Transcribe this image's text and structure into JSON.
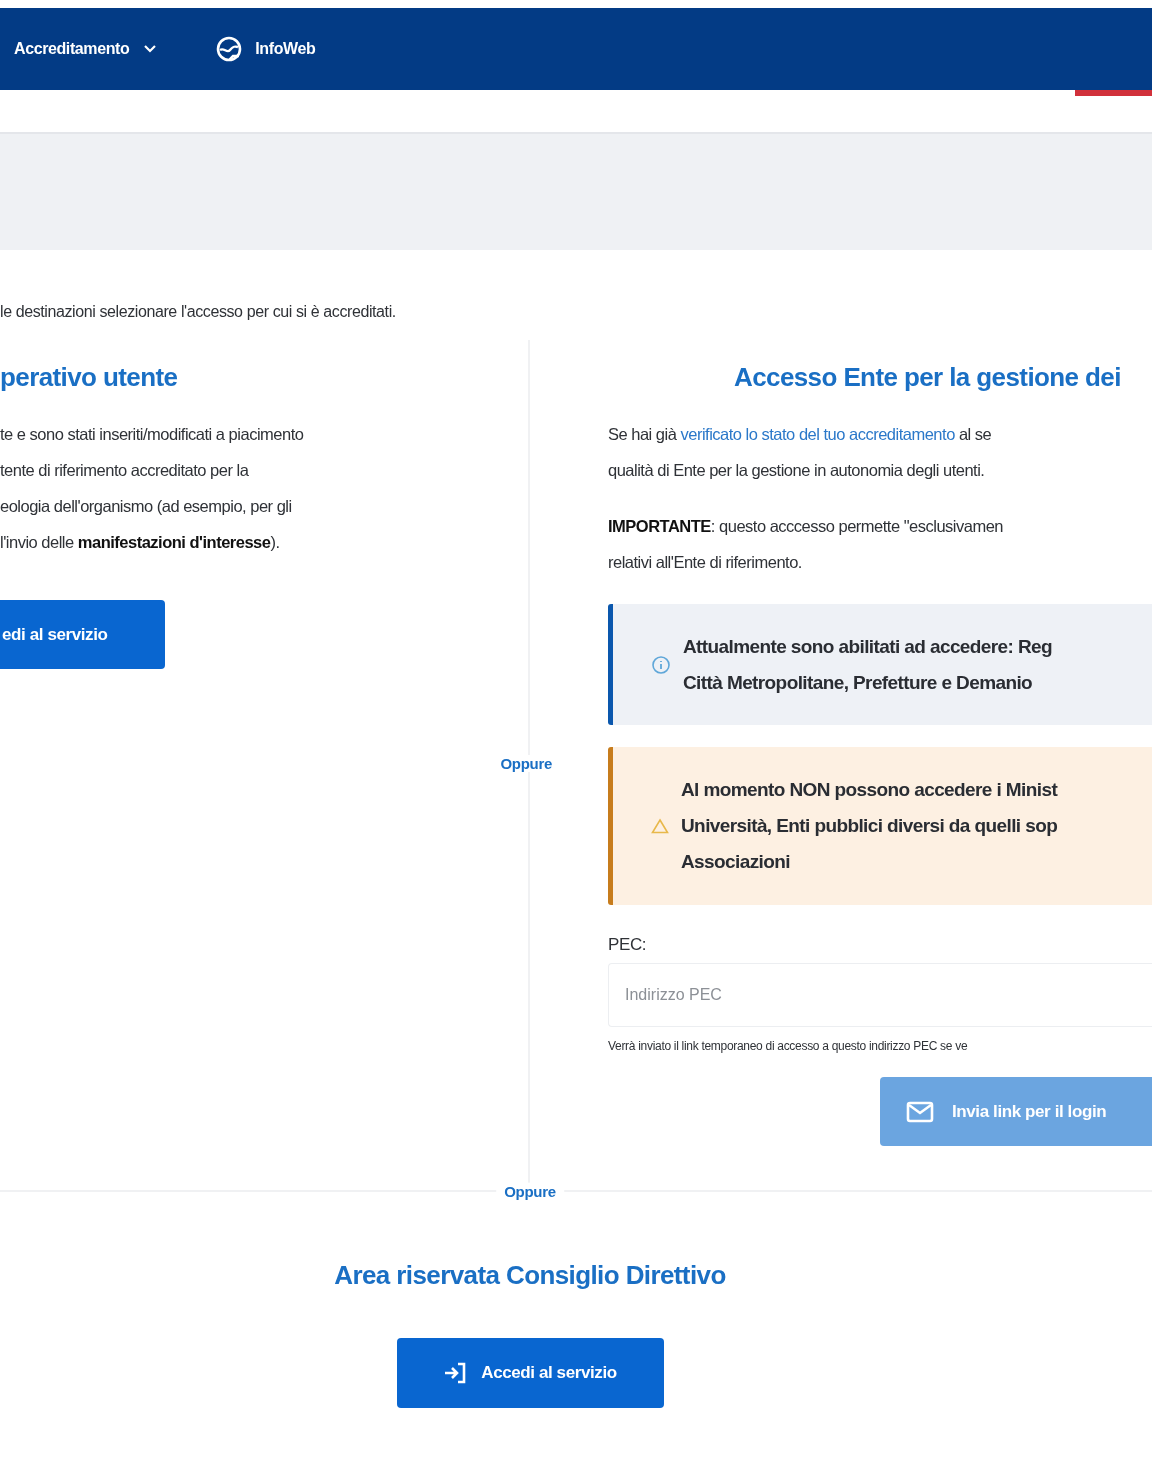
{
  "nav": {
    "items": [
      {
        "label": "Accreditamento",
        "kind": "dropdown"
      },
      {
        "label": "InfoWeb",
        "kind": "link"
      }
    ]
  },
  "intro": "le destinazioni selezionare l'accesso per cui si è accreditati.",
  "left": {
    "title": "perativo utente",
    "lines": [
      "te e sono stati inseriti/modificati a piacimento",
      "tente di riferimento accreditato per la",
      "eologia dell'organismo (ad esempio, per gli",
      " l'invio delle **manifestazioni d'interesse**)."
    ],
    "button": "edi al servizio"
  },
  "divider_label": "Oppure",
  "right": {
    "title": "Accesso Ente per la gestione dei",
    "intro": {
      "before": "Se hai già ",
      "link": "verificato lo stato del tuo accreditamento",
      "after": " al se",
      "line_2": "qualità di Ente per la gestione in autonomia degli utenti."
    },
    "important": [
      "**IMPORTANTE**: questo acccesso permette \"esclusivamen",
      "relativi all'Ente di riferimento."
    ],
    "alerts": [
      {
        "kind": "info",
        "lines": [
          "Attualmente sono abilitati ad accedere: Reg",
          "Città Metropolitane, Prefetture e Demanio"
        ]
      },
      {
        "kind": "warning",
        "lines": [
          "Al momento NON possono accedere i Minist",
          "Università, Enti pubblici diversi da quelli sop",
          "Associazioni"
        ]
      }
    ],
    "pec": {
      "label": "PEC:",
      "placeholder": "Indirizzo PEC",
      "hint": "Verrà inviato il link temporaneo di accesso a questo indirizzo PEC se ve"
    },
    "button": {
      "label": "Invia link per il login",
      "disabled": true
    }
  },
  "bottom": {
    "divider_label": "Oppure",
    "title": "Area riservata Consiglio Direttivo",
    "button": "Accedi al servizio"
  }
}
